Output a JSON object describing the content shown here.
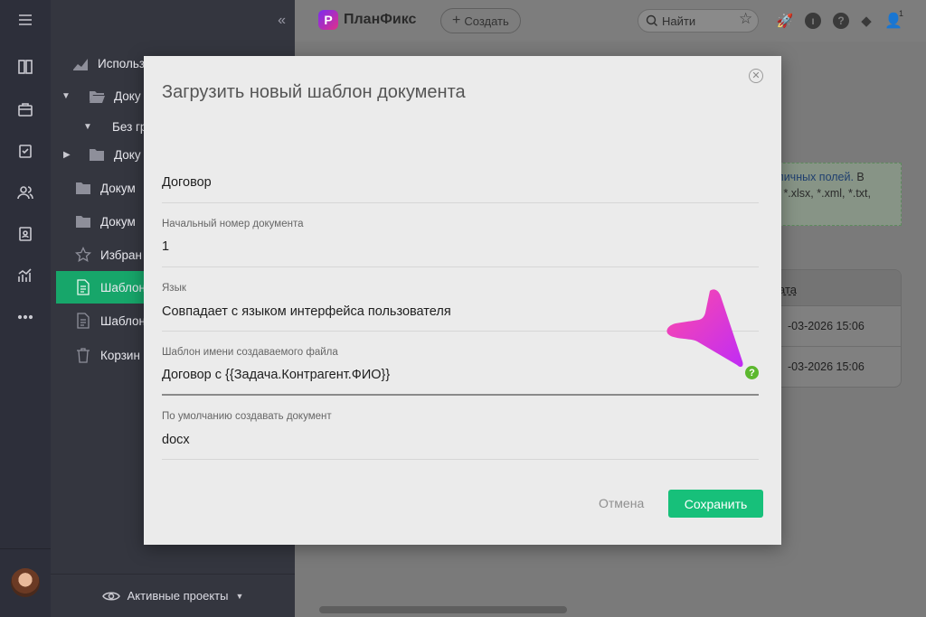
{
  "app": {
    "name": "ПланФикс",
    "logo_letter": "P"
  },
  "topbar": {
    "create_label": "Создать",
    "search_placeholder": "Найти",
    "notifications_count": "1"
  },
  "sidebar": {
    "items": [
      {
        "label": "Использ",
        "icon": "chart-icon"
      },
      {
        "label": "Доку",
        "icon": "folder-open-icon",
        "caret": "▼"
      },
      {
        "label": "Без гр",
        "icon": "",
        "caret": "▼"
      },
      {
        "label": "Доку",
        "icon": "folder-icon",
        "caret": "▶"
      },
      {
        "label": "Докум",
        "icon": "folder-icon"
      },
      {
        "label": "Докум",
        "icon": "folder-icon"
      },
      {
        "label": "Избран",
        "icon": "star-icon"
      },
      {
        "label": "Шаблон",
        "icon": "document-icon",
        "active": true
      },
      {
        "label": "Шаблон",
        "icon": "document-icon"
      },
      {
        "label": "Корзин",
        "icon": "trash-icon"
      }
    ],
    "bottom_label": "Активные проекты"
  },
  "background": {
    "note_link": "азличных полей.",
    "note_tail": " В",
    "note_line2": "cx, *.xlsx, *.xml, *.txt,",
    "table_header": "ата",
    "rows": [
      "-03-2026 15:06",
      "-03-2026 15:06"
    ]
  },
  "modal": {
    "title": "Загрузить новый шаблон документа",
    "name_value": "Договор",
    "fields": [
      {
        "label": "Начальный номер документа",
        "value": "1"
      },
      {
        "label": "Язык",
        "value": "Совпадает с языком интерфейса пользователя"
      },
      {
        "label": "Шаблон имени создаваемого файла",
        "value": "Договор с {{Задача.Контрагент.ФИО}}"
      },
      {
        "label": "По умолчанию создавать документ",
        "value": "docx"
      }
    ],
    "help_glyph": "?",
    "cancel_label": "Отмена",
    "save_label": "Сохранить"
  },
  "colors": {
    "accent_green": "#17c07a",
    "sidebar_active": "#17a66a",
    "help_green": "#5cb82e",
    "pointer_gradient": [
      "#ff3aa0",
      "#c030ff"
    ]
  }
}
